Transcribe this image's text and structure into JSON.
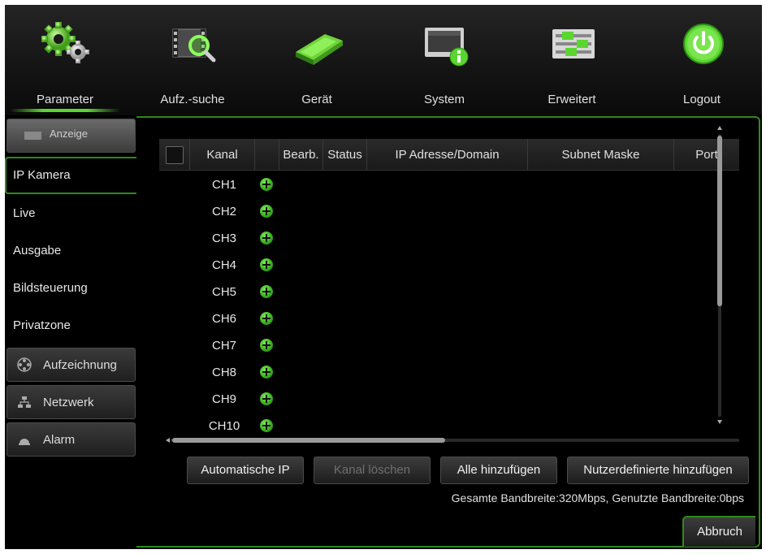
{
  "nav": [
    {
      "id": "parameter",
      "label": "Parameter",
      "icon": "gears-icon",
      "active": true
    },
    {
      "id": "aufz-suche",
      "label": "Aufz.-suche",
      "icon": "film-search-icon"
    },
    {
      "id": "geraet",
      "label": "Gerät",
      "icon": "hard-drive-icon"
    },
    {
      "id": "system",
      "label": "System",
      "icon": "monitor-info-icon"
    },
    {
      "id": "erweitert",
      "label": "Erweitert",
      "icon": "sliders-icon"
    },
    {
      "id": "logout",
      "label": "Logout",
      "icon": "power-icon"
    }
  ],
  "sidebar": {
    "anzeige": "Anzeige",
    "items": [
      "IP Kamera",
      "Live",
      "Ausgabe",
      "Bildsteuerung",
      "Privatzone"
    ],
    "active_item": "IP Kamera",
    "sections": [
      {
        "label": "Aufzeichnung",
        "icon": "film-reel-icon"
      },
      {
        "label": "Netzwerk",
        "icon": "network-icon"
      },
      {
        "label": "Alarm",
        "icon": "alarm-icon"
      }
    ]
  },
  "table": {
    "headers": {
      "kanal": "Kanal",
      "bearb": "Bearb.",
      "status": "Status",
      "ip": "IP Adresse/Domain",
      "subnet": "Subnet Maske",
      "port": "Port"
    },
    "rows": [
      "CH1",
      "CH2",
      "CH3",
      "CH4",
      "CH5",
      "CH6",
      "CH7",
      "CH8",
      "CH9",
      "CH10"
    ]
  },
  "buttons": {
    "auto_ip": "Automatische IP",
    "kanal_loeschen": "Kanal löschen",
    "alle_hinzufuegen": "Alle hinzufügen",
    "nutzerdef": "Nutzerdefinierte hinzufügen",
    "abbruch": "Abbruch"
  },
  "bandwidth": "Gesamte Bandbreite:320Mbps, Genutzte Bandbreite:0bps",
  "colors": {
    "accent": "#5bd631",
    "border": "#2f8a1b",
    "background": "#000000"
  }
}
